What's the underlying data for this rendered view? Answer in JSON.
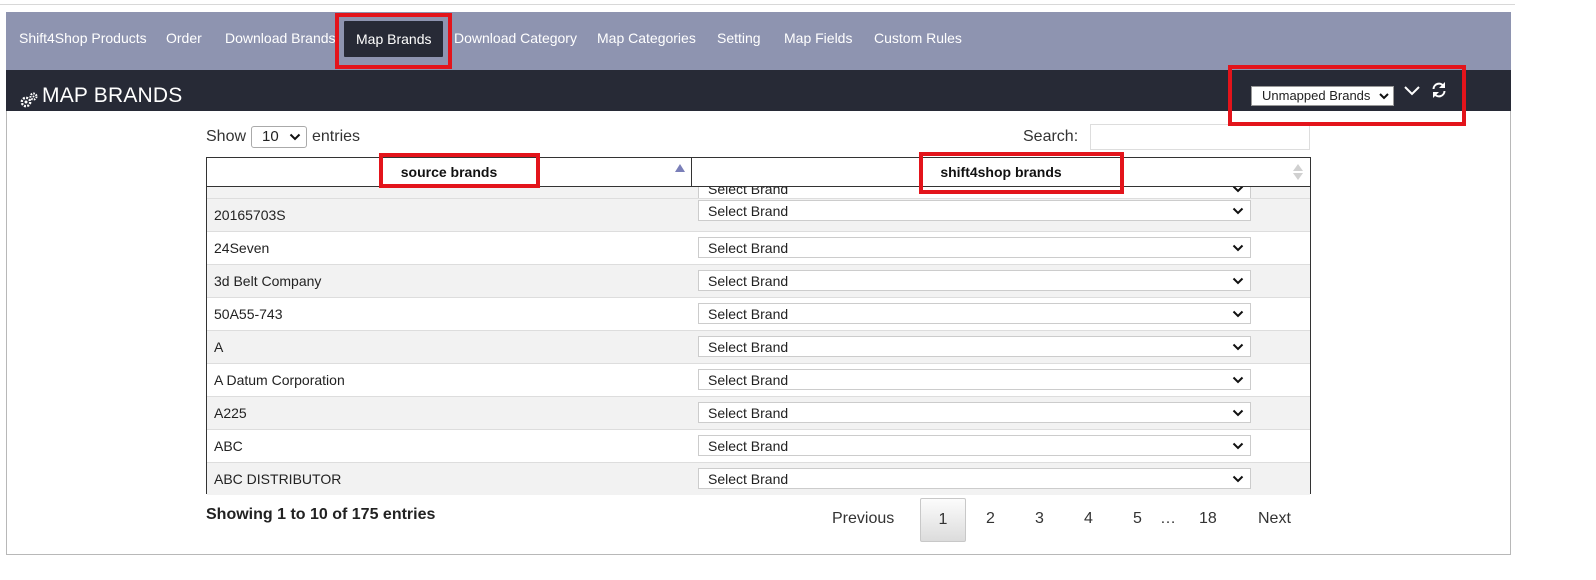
{
  "nav": {
    "items": [
      {
        "label": "Shift4Shop Products",
        "active": false
      },
      {
        "label": "Order",
        "active": false
      },
      {
        "label": "Download Brands",
        "active": false
      },
      {
        "label": "Map Brands",
        "active": true
      },
      {
        "label": "Download Category",
        "active": false
      },
      {
        "label": "Map Categories",
        "active": false
      },
      {
        "label": "Setting",
        "active": false
      },
      {
        "label": "Map Fields",
        "active": false
      },
      {
        "label": "Custom Rules",
        "active": false
      }
    ]
  },
  "header": {
    "title": "MAP BRANDS",
    "icon": "gears-icon",
    "filter_value": "Unmapped Brands"
  },
  "controls": {
    "show_label": "Show",
    "entries_value": "10",
    "entries_label": "entries",
    "search_label": "Search:",
    "search_value": ""
  },
  "table": {
    "columns": [
      "source brands",
      "shift4shop brands"
    ],
    "partial_row_select": "Select Brand",
    "rows": [
      {
        "source": "20165703S",
        "target": "Select Brand"
      },
      {
        "source": "24Seven",
        "target": "Select Brand"
      },
      {
        "source": "3d Belt Company",
        "target": "Select Brand"
      },
      {
        "source": "50A55-743",
        "target": "Select Brand"
      },
      {
        "source": "A",
        "target": "Select Brand"
      },
      {
        "source": "A Datum Corporation",
        "target": "Select Brand"
      },
      {
        "source": "A225",
        "target": "Select Brand"
      },
      {
        "source": "ABC",
        "target": "Select Brand"
      },
      {
        "source": "ABC DISTRIBUTOR",
        "target": "Select Brand"
      }
    ]
  },
  "footer": {
    "info": "Showing 1 to 10 of 175 entries",
    "previous": "Previous",
    "pages": [
      "1",
      "2",
      "3",
      "4",
      "5"
    ],
    "ellipsis": "…",
    "last_page": "18",
    "next": "Next",
    "current_page": "1"
  },
  "colors": {
    "nav_bg": "#8e94b0",
    "header_bg": "#272a36",
    "highlight": "#e3141b"
  }
}
